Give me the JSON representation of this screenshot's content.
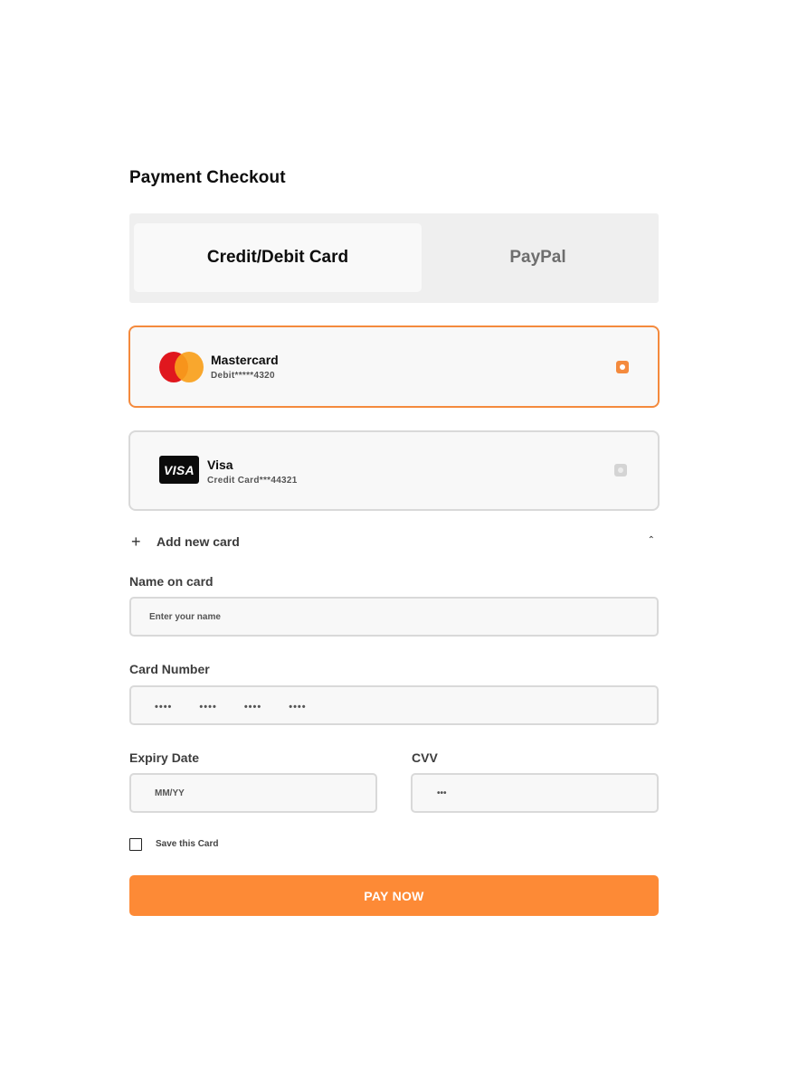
{
  "page": {
    "title": "Payment Checkout"
  },
  "tabs": [
    {
      "label": "Credit/Debit Card",
      "active": true
    },
    {
      "label": "PayPal",
      "active": false
    }
  ],
  "saved_cards": [
    {
      "brand": "Mastercard",
      "detail": "Debit*****4320",
      "selected": true,
      "icon": "mastercard-logo"
    },
    {
      "brand": "Visa",
      "detail": "Credit Card***44321",
      "selected": false,
      "icon": "visa-logo",
      "logo_text": "VISA"
    }
  ],
  "add_card": {
    "label": "Add new card",
    "icon": "plus-icon",
    "toggle_icon": "chevron-up-icon"
  },
  "form": {
    "name": {
      "label": "Name on card",
      "placeholder": "Enter your name"
    },
    "number": {
      "label": "Card  Number",
      "groups": [
        "••••",
        "••••",
        "••••",
        "••••"
      ]
    },
    "expiry": {
      "label": "Expiry Date",
      "placeholder": "MM/YY"
    },
    "cvv": {
      "label": "CVV",
      "placeholder": "•••"
    },
    "save_card": {
      "label": "Save this Card",
      "checked": false
    }
  },
  "pay_button": {
    "label": "PAY NOW"
  },
  "colors": {
    "accent": "#fd8a36",
    "border": "#d9d9d9",
    "field_bg": "#f8f8f8"
  }
}
